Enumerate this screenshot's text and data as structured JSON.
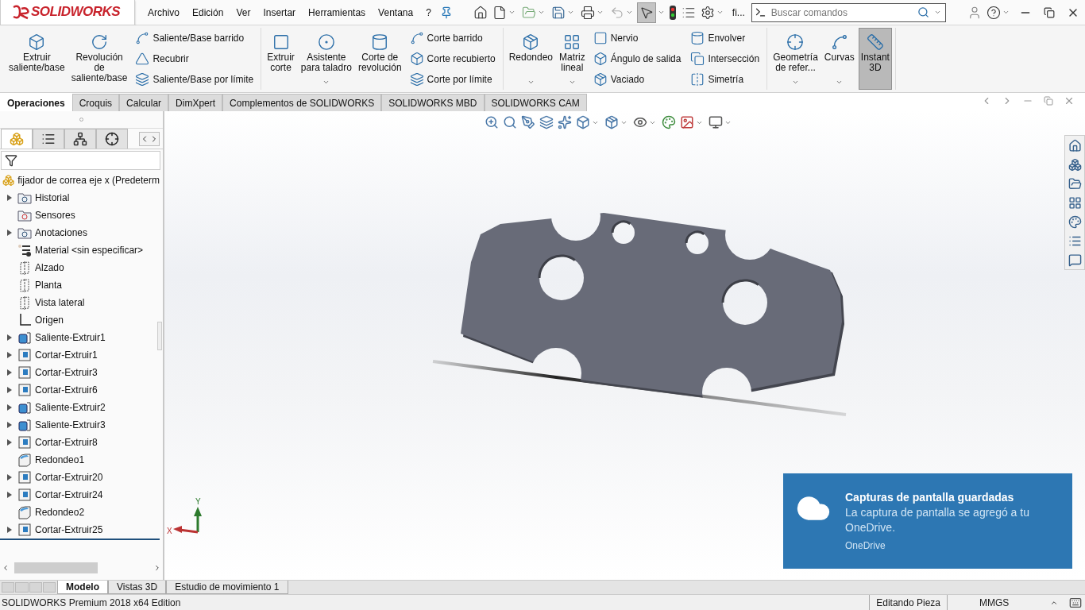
{
  "logo": "SOLIDWORKS",
  "menu": [
    "Archivo",
    "Edición",
    "Ver",
    "Insertar",
    "Herramientas",
    "Ventana",
    "?"
  ],
  "select_tool": {
    "selected": true
  },
  "document_title": "fi...",
  "search": {
    "placeholder": "Buscar comandos"
  },
  "ribbon": {
    "groups": [
      {
        "items": [
          {
            "kind": "large",
            "label": "Extruir\nsaliente/base"
          },
          {
            "kind": "large",
            "label": "Revolución\nde\nsaliente/base"
          },
          {
            "kind": "stack",
            "items": [
              "Saliente/Base barrido",
              "Recubrir",
              "Saliente/Base por límite"
            ]
          }
        ]
      },
      {
        "items": [
          {
            "kind": "large",
            "label": "Extruir\ncorte"
          },
          {
            "kind": "large",
            "label": "Asistente\npara taladro",
            "menu": true
          },
          {
            "kind": "large",
            "label": "Corte de\nrevolución"
          },
          {
            "kind": "stack",
            "items": [
              "Corte barrido",
              "Corte recubierto",
              "Corte por límite"
            ]
          }
        ]
      },
      {
        "items": [
          {
            "kind": "large",
            "label": "Redondeo",
            "menu": true
          },
          {
            "kind": "large",
            "label": "Matriz\nlineal",
            "menu": true
          },
          {
            "kind": "stack",
            "items": [
              "Nervio",
              "Ángulo de salida",
              "Vaciado"
            ]
          },
          {
            "kind": "stack",
            "items": [
              "Envolver",
              "Intersección",
              "Simetría"
            ]
          }
        ]
      },
      {
        "items": [
          {
            "kind": "large",
            "label": "Geometría\nde refer...",
            "menu": true
          },
          {
            "kind": "large",
            "label": "Curvas",
            "menu": true
          },
          {
            "kind": "large",
            "label": "Instant\n3D",
            "selected": true
          }
        ]
      }
    ]
  },
  "command_tabs": [
    {
      "label": "Operaciones",
      "selected": true
    },
    {
      "label": "Croquis",
      "selected": false
    },
    {
      "label": "Calcular",
      "selected": false
    },
    {
      "label": "DimXpert",
      "selected": false
    },
    {
      "label": "Complementos de SOLIDWORKS",
      "selected": false
    },
    {
      "label": "SOLIDWORKS MBD",
      "selected": false
    },
    {
      "label": "SOLIDWORKS CAM",
      "selected": false
    }
  ],
  "feature_panel": {
    "tabs": [
      {
        "selected": true
      },
      {
        "selected": false
      },
      {
        "selected": false
      },
      {
        "selected": false
      }
    ],
    "root": "fijador de correa eje x  (Predeterm",
    "items": [
      {
        "kind": "history",
        "label": "Historial",
        "expandable": true
      },
      {
        "kind": "sensors",
        "label": "Sensores",
        "expandable": false
      },
      {
        "kind": "annotations",
        "label": "Anotaciones",
        "expandable": true
      },
      {
        "kind": "material",
        "label": "Material <sin especificar>",
        "expandable": false
      },
      {
        "kind": "plane",
        "label": "Alzado",
        "expandable": false
      },
      {
        "kind": "plane",
        "label": "Planta",
        "expandable": false
      },
      {
        "kind": "plane",
        "label": "Vista lateral",
        "expandable": false
      },
      {
        "kind": "origin",
        "label": "Origen",
        "expandable": false
      },
      {
        "kind": "boss",
        "label": "Saliente-Extruir1",
        "expandable": true
      },
      {
        "kind": "cut",
        "label": "Cortar-Extruir1",
        "expandable": true
      },
      {
        "kind": "cut",
        "label": "Cortar-Extruir3",
        "expandable": true
      },
      {
        "kind": "cut",
        "label": "Cortar-Extruir6",
        "expandable": true
      },
      {
        "kind": "boss",
        "label": "Saliente-Extruir2",
        "expandable": true
      },
      {
        "kind": "boss",
        "label": "Saliente-Extruir3",
        "expandable": true
      },
      {
        "kind": "cut",
        "label": "Cortar-Extruir8",
        "expandable": true
      },
      {
        "kind": "fillet",
        "label": "Redondeo1",
        "expandable": false
      },
      {
        "kind": "cut",
        "label": "Cortar-Extruir20",
        "expandable": true
      },
      {
        "kind": "cut",
        "label": "Cortar-Extruir24",
        "expandable": true
      },
      {
        "kind": "fillet",
        "label": "Redondeo2",
        "expandable": false
      },
      {
        "kind": "cut",
        "label": "Cortar-Extruir25",
        "expandable": true
      }
    ]
  },
  "triad": {
    "x": "X",
    "y": "Y"
  },
  "notification": {
    "title": "Capturas de pantalla guardadas",
    "message": "La captura de pantalla se agregó a tu OneDrive.",
    "source": "OneDrive"
  },
  "model_tabs": [
    {
      "label": "Modelo",
      "selected": true
    },
    {
      "label": "Vistas 3D",
      "selected": false
    },
    {
      "label": "Estudio de movimiento 1",
      "selected": false
    }
  ],
  "status_bar": {
    "product": "SOLIDWORKS Premium 2018 x64 Edition",
    "mode": "Editando Pieza",
    "units": "MMGS"
  }
}
